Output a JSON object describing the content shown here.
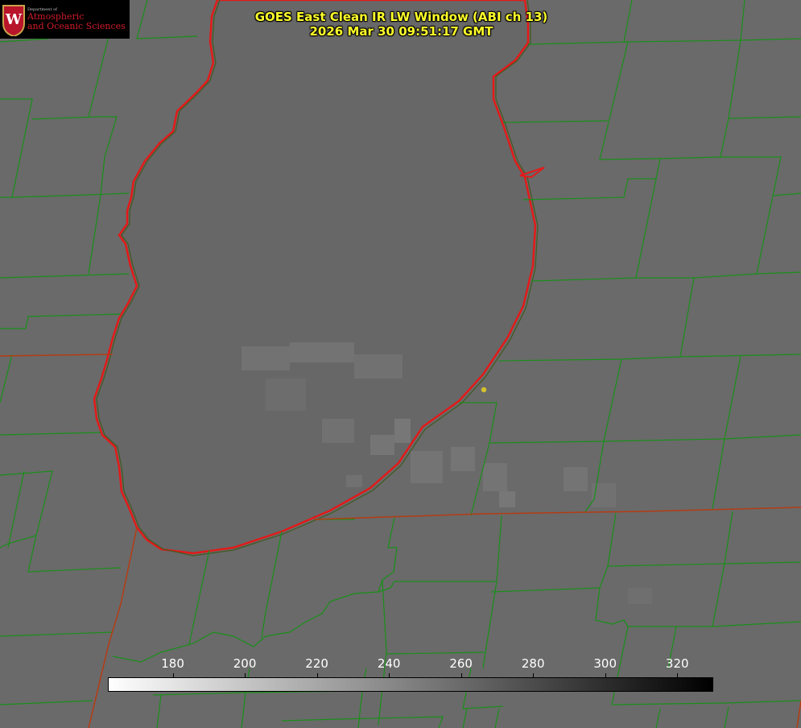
{
  "header": {
    "title": "GOES East Clean IR LW Window (ABI ch 13)",
    "timestamp": "2026 Mar 30 09:51:17 GMT"
  },
  "logo": {
    "department": "Department of",
    "line1": "Atmospheric",
    "line2": "and Oceanic Sciences",
    "seal_letter": "W"
  },
  "colorbar": {
    "min": 162,
    "max": 330,
    "ticks": [
      "180",
      "200",
      "220",
      "240",
      "260",
      "280",
      "300",
      "320"
    ],
    "gradient": [
      "#ffffff",
      "#000000"
    ],
    "units": ""
  },
  "colors": {
    "background": "#6a6a6a",
    "lake": "#676767",
    "county_lines": "#1a8f1a",
    "state_lines": "#b43c14",
    "lake_shoreline": "#e21a1a",
    "title_text": "#ffff2a",
    "marker": "#d4c22c"
  },
  "map_features": {
    "lake": "lake-michigan",
    "marker": "station-marker"
  }
}
